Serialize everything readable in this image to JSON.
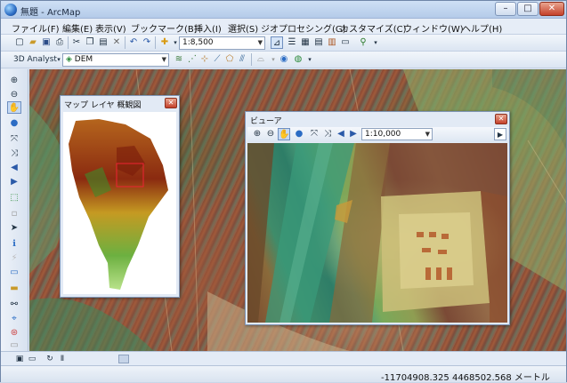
{
  "window": {
    "title": "無題 - ArcMap",
    "controls": {
      "minimize": "–",
      "maximize": "□",
      "close": "✕"
    }
  },
  "menu": [
    "ファイル(F)",
    "編集(E)",
    "表示(V)",
    "ブックマーク(B)",
    "挿入(I)",
    "選択(S)",
    "ジオプロセシング(G)",
    "カスタマイズ(C)",
    "ウィンドウ(W)",
    "ヘルプ(H)"
  ],
  "toolbar1": {
    "icons": [
      "new-document-icon",
      "open-icon",
      "save-icon",
      "print-icon",
      "cut-icon",
      "copy-icon",
      "paste-icon",
      "delete-icon",
      "undo-icon",
      "redo-icon",
      "add-data-icon"
    ],
    "scale": "1:8,500"
  },
  "toolbar2": {
    "analyst_label": "3D Analyst",
    "layer": "DEM"
  },
  "overview_window": {
    "title": "マップ レイヤ 概観図",
    "close": "✕"
  },
  "viewer_window": {
    "title": "ビューア",
    "close": "✕",
    "scale": "1:10,000",
    "next": "▶"
  },
  "statusbar": {
    "coordinates": "-11704908.325  4468502.568 メートル"
  }
}
